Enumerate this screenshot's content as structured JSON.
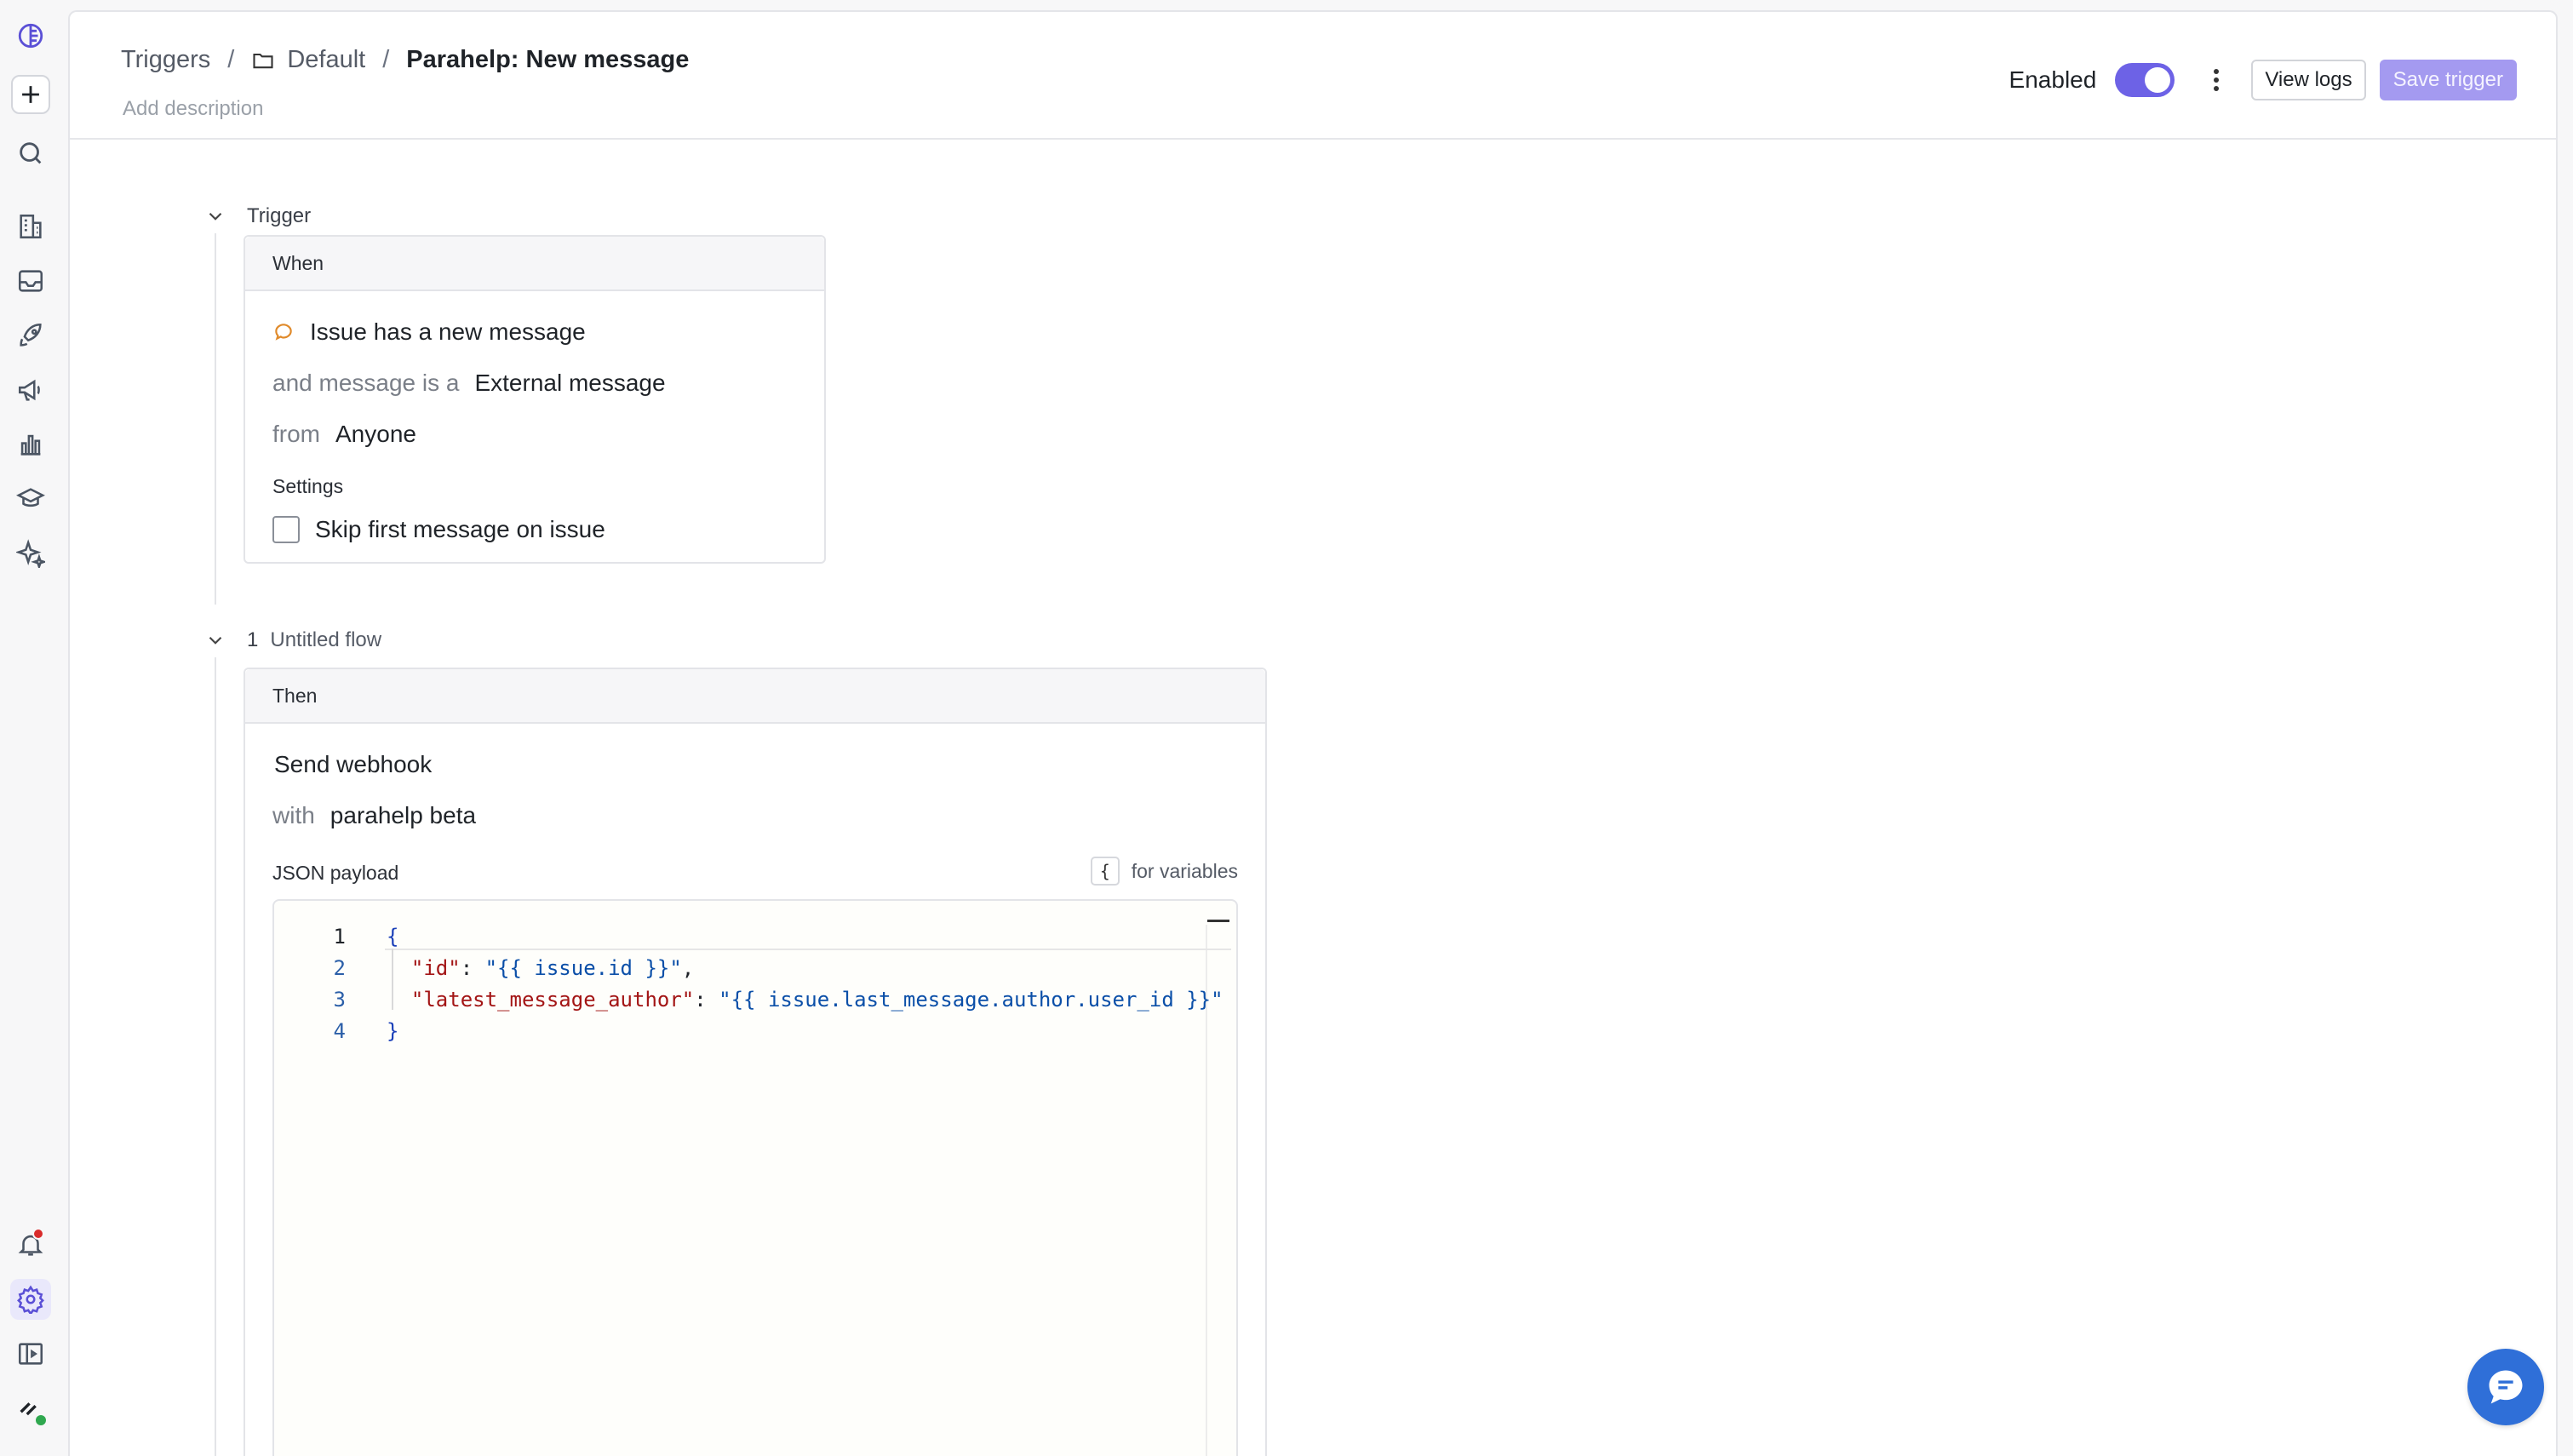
{
  "breadcrumb": {
    "root": "Triggers",
    "separator": "/",
    "folder": "Default",
    "current": "Parahelp: New message"
  },
  "header": {
    "add_description": "Add description",
    "enabled_label": "Enabled",
    "enabled": true,
    "view_logs": "View logs",
    "save_trigger": "Save trigger"
  },
  "trigger_section": {
    "title": "Trigger",
    "card_header": "When",
    "event": "Issue has a new message",
    "message_type_prefix": "and message is a",
    "message_type": "External message",
    "from_prefix": "from",
    "from_value": "Anyone",
    "settings_label": "Settings",
    "skip_first_label": "Skip first message on issue",
    "skip_first_checked": false
  },
  "flow_section": {
    "number": "1",
    "title": "Untitled flow",
    "card_header": "Then",
    "action": "Send webhook",
    "with_prefix": "with",
    "with_value": "parahelp beta",
    "payload_label": "JSON payload",
    "vars_brace": "{",
    "vars_hint": "for variables",
    "code_lines": [
      {
        "n": "1",
        "parts": [
          {
            "t": "{",
            "c": "tk-brace"
          }
        ]
      },
      {
        "n": "2",
        "parts": [
          {
            "t": "  ",
            "c": "tk-punc"
          },
          {
            "t": "\"id\"",
            "c": "tk-key"
          },
          {
            "t": ": ",
            "c": "tk-punc"
          },
          {
            "t": "\"{{ issue.id }}\"",
            "c": "tk-str"
          },
          {
            "t": ",",
            "c": "tk-punc"
          }
        ]
      },
      {
        "n": "3",
        "parts": [
          {
            "t": "  ",
            "c": "tk-punc"
          },
          {
            "t": "\"latest_message_author\"",
            "c": "tk-key"
          },
          {
            "t": ": ",
            "c": "tk-punc"
          },
          {
            "t": "\"{{ issue.last_message.author.user_id }}\"",
            "c": "tk-str"
          }
        ]
      },
      {
        "n": "4",
        "parts": [
          {
            "t": "}",
            "c": "tk-brace"
          }
        ]
      }
    ]
  },
  "sidebar": {
    "items": [
      {
        "name": "logo-icon"
      },
      {
        "name": "new-item-button"
      },
      {
        "name": "search-icon"
      },
      {
        "name": "buildings-icon"
      },
      {
        "name": "inbox-icon"
      },
      {
        "name": "rocket-icon"
      },
      {
        "name": "megaphone-icon"
      },
      {
        "name": "chart-icon"
      },
      {
        "name": "graduation-cap-icon"
      },
      {
        "name": "sparkles-icon"
      },
      {
        "name": "bell-icon"
      },
      {
        "name": "settings-icon"
      },
      {
        "name": "panel-icon"
      },
      {
        "name": "profile-icon"
      }
    ]
  },
  "colors": {
    "accent": "#6d62e6",
    "primary_button": "#a49af0",
    "notification": "#d92b2b",
    "online": "#2fa84f",
    "chat": "#2f6fd8"
  }
}
